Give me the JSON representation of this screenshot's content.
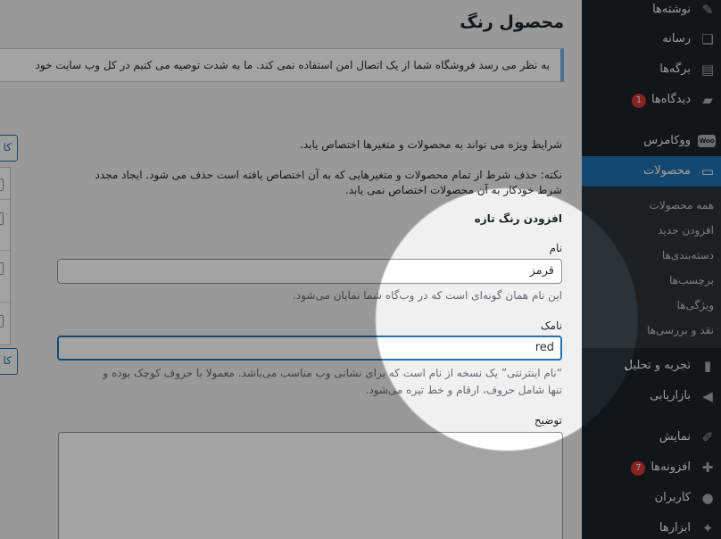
{
  "page": {
    "title": "محصول رنگ"
  },
  "notice": {
    "text": "به نظر می رسد فروشگاه شما از یک اتصال امن استفاده نمی کند. ما به شدت توصیه می کنیم در کل وب سایت خود"
  },
  "left_buttons": {
    "label": "کا"
  },
  "intro": {
    "line1": "شرایط ویژه می تواند به محصولات و متغیرها اختصاص یابد.",
    "line2": "نکته: حذف شرط از تمام محصولات و متغیرهایی که به آن اختصاص یافته است حذف می شود. ایجاد مجدد",
    "line3": "شرط خودکار به آن محصولات اختصاص نمی یابد."
  },
  "form": {
    "heading": "افزودن رنگ تازه",
    "name_label": "نام",
    "name_value": "قرمز",
    "name_desc": "این نام همان گونه‌ای است که در وب‌گاه شما نمایان می‌شود.",
    "slug_label": "نامک",
    "slug_value": "red",
    "slug_desc_1": "“نام اینترنتی” یک نسخه از نام است که برای نشانی وب مناسب می‌باشد. معمولا با حروف کوچک بوده و",
    "slug_desc_2": "تنها شامل حروف، ارقام و خط تیره می‌شود.",
    "description_label": "توضیح"
  },
  "sidebar": {
    "posts": "نوشته‌ها",
    "media": "رسانه",
    "pages": "برگه‌ها",
    "comments": "دیدگاه‌ها",
    "comments_badge": "1",
    "woocommerce": "ووکامرس",
    "woo_icon_text": "Woo",
    "products": "محصولات",
    "submenu": {
      "all_products": "همه محصولات",
      "add_new": "افزودن جدید",
      "categories": "دسته‌بندی‌ها",
      "tags": "برچسب‌ها",
      "attributes": "ویژگی‌ها",
      "reviews": "نقد و بررسی‌ها"
    },
    "analytics": "تجربه و تحلیل",
    "marketing": "بازاریابی",
    "appearance": "نمایش",
    "plugins": "افزونه‌ها",
    "plugins_badge": "7",
    "users": "کاربران",
    "tools": "ابزارها"
  },
  "colors": {
    "sidebar_bg": "#1d2327",
    "accent": "#2271b1",
    "badge": "#d63638"
  }
}
